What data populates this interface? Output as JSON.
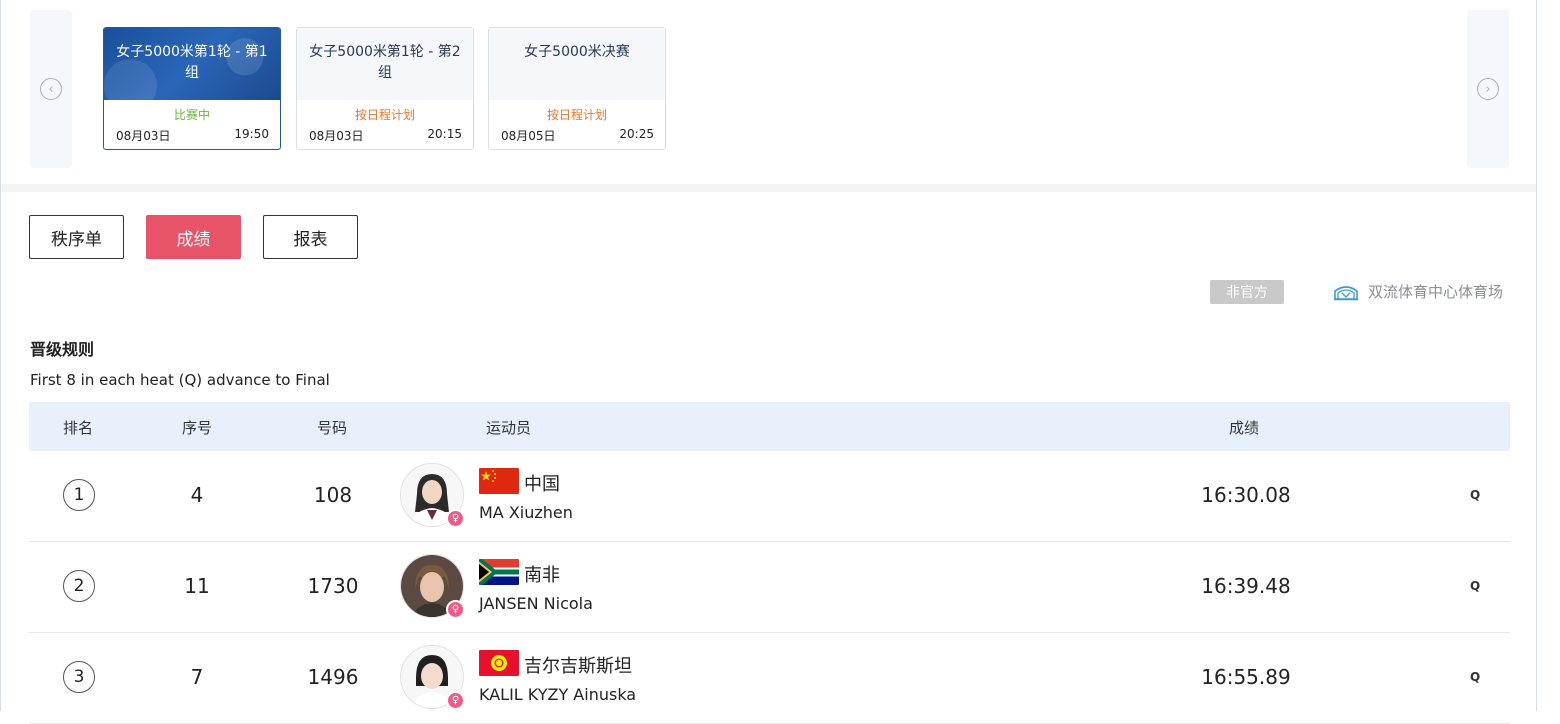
{
  "carousel": {
    "events": [
      {
        "title": "女子5000米第1轮 - 第1组",
        "status": "比赛中",
        "status_type": "live",
        "date": "08月03日",
        "time": "19:50",
        "active": true
      },
      {
        "title": "女子5000米第1轮 - 第2组",
        "status": "按日程计划",
        "status_type": "planned",
        "date": "08月03日",
        "time": "20:15",
        "active": false
      },
      {
        "title": "女子5000米决赛",
        "status": "按日程计划",
        "status_type": "planned",
        "date": "08月05日",
        "time": "20:25",
        "active": false
      }
    ],
    "prev_icon": "chevron-left-circle-icon",
    "next_icon": "chevron-right-circle-icon"
  },
  "tabs": {
    "start_list": "秩序单",
    "results": "成绩",
    "report": "报表",
    "active": "results"
  },
  "status_badge": "非官方",
  "venue": {
    "name": "双流体育中心体育场",
    "icon": "stadium-icon"
  },
  "rules": {
    "title": "晋级规则",
    "text": "First 8 in each heat (Q) advance to Final"
  },
  "table": {
    "headers": {
      "rank": "排名",
      "seq": "序号",
      "bib": "号码",
      "athlete": "运动员",
      "result": "成绩"
    },
    "rows": [
      {
        "rank": "1",
        "seq": "4",
        "bib": "108",
        "country": "中国",
        "flag": "china-flag",
        "name": "MA Xiuzhen",
        "result": "16:30.08",
        "qual": "Q"
      },
      {
        "rank": "2",
        "seq": "11",
        "bib": "1730",
        "country": "南非",
        "flag": "south-africa-flag",
        "name": "JANSEN Nicola",
        "result": "16:39.48",
        "qual": "Q"
      },
      {
        "rank": "3",
        "seq": "7",
        "bib": "1496",
        "country": "吉尔吉斯斯坦",
        "flag": "kyrgyzstan-flag",
        "name": "KALIL KYZY Ainuska",
        "result": "16:55.89",
        "qual": "Q"
      }
    ]
  },
  "colors": {
    "accent": "#e85467",
    "live": "#6bb33c",
    "planned": "#e8772e",
    "header_bg": "#e8f0fc",
    "gender_female": "#ef5b86"
  }
}
